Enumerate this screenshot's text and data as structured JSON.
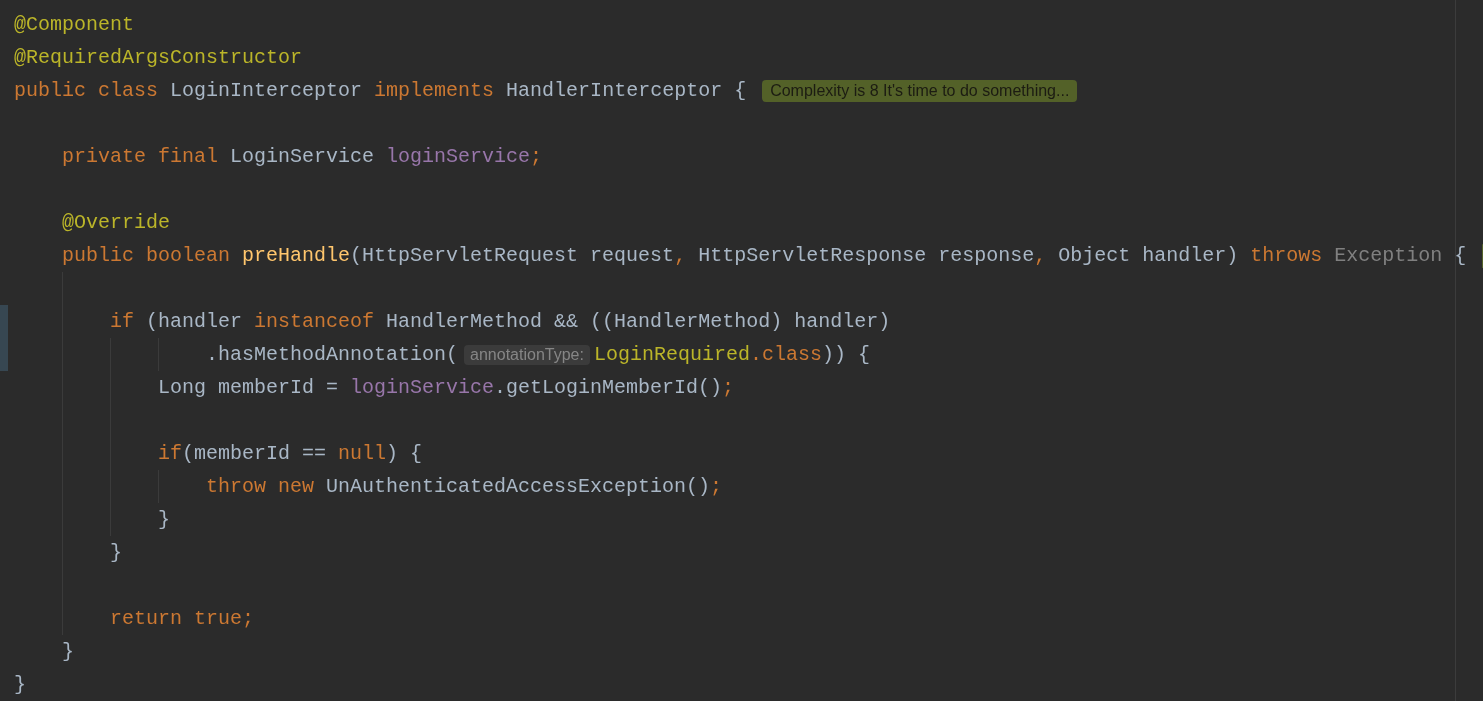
{
  "editor": {
    "lines": [
      {
        "kind": "code",
        "modified": false,
        "segments": [
          {
            "kind": "code",
            "tokens": [
              {
                "kind": "annotation",
                "text": "@Component"
              }
            ]
          }
        ]
      },
      {
        "kind": "code",
        "modified": false,
        "segments": [
          {
            "kind": "code",
            "tokens": [
              {
                "kind": "annotation",
                "text": "@RequiredArgsConstructor"
              }
            ]
          }
        ]
      },
      {
        "kind": "code",
        "modified": false,
        "segments": [
          {
            "kind": "code",
            "tokens": [
              {
                "kind": "keyword",
                "text": "public class "
              },
              {
                "kind": "plain",
                "text": "LoginInterceptor "
              },
              {
                "kind": "keyword",
                "text": "implements "
              },
              {
                "kind": "plain",
                "text": "HandlerInterceptor {"
              }
            ]
          },
          {
            "kind": "badge",
            "text": "Complexity is 8 It's time to do something..."
          }
        ],
        "children": [
          {
            "kind": "blank",
            "modified": false
          },
          {
            "kind": "code",
            "modified": false,
            "segments": [
              {
                "kind": "code",
                "tokens": [
                  {
                    "kind": "keyword",
                    "text": "private final "
                  },
                  {
                    "kind": "plain",
                    "text": "LoginService "
                  },
                  {
                    "kind": "field",
                    "text": "loginService"
                  },
                  {
                    "kind": "keyword",
                    "text": ";"
                  }
                ]
              }
            ]
          },
          {
            "kind": "blank",
            "modified": false
          },
          {
            "kind": "code",
            "modified": false,
            "segments": [
              {
                "kind": "code",
                "tokens": [
                  {
                    "kind": "annotation",
                    "text": "@Override"
                  }
                ]
              }
            ]
          },
          {
            "kind": "code",
            "modified": false,
            "segments": [
              {
                "kind": "code",
                "tokens": [
                  {
                    "kind": "keyword",
                    "text": "public boolean "
                  },
                  {
                    "kind": "method",
                    "text": "preHandle"
                  },
                  {
                    "kind": "plain",
                    "text": "(HttpServletRequest request"
                  },
                  {
                    "kind": "keyword",
                    "text": ", "
                  },
                  {
                    "kind": "plain",
                    "text": "HttpServletResponse response"
                  },
                  {
                    "kind": "keyword",
                    "text": ", "
                  },
                  {
                    "kind": "plain",
                    "text": "Object handler) "
                  },
                  {
                    "kind": "keyword",
                    "text": "throws "
                  },
                  {
                    "kind": "dim",
                    "text": "Exception "
                  },
                  {
                    "kind": "plain",
                    "text": "{"
                  }
                ]
              },
              {
                "kind": "badge"
              }
            ],
            "children": [
              {
                "kind": "blank",
                "modified": false
              },
              {
                "kind": "code",
                "modified": true,
                "segments": [
                  {
                    "kind": "code",
                    "tokens": [
                      {
                        "kind": "keyword",
                        "text": "if "
                      },
                      {
                        "kind": "plain",
                        "text": "(handler "
                      },
                      {
                        "kind": "keyword",
                        "text": "instanceof "
                      },
                      {
                        "kind": "plain",
                        "text": "HandlerMethod && ((HandlerMethod) handler)"
                      }
                    ]
                  }
                ],
                "children": [
                  {
                    "kind": "continuation",
                    "modified": true,
                    "segments": [
                      {
                        "kind": "code",
                        "tokens": [
                          {
                            "kind": "plain",
                            "text": ".hasMethodAnnotation("
                          }
                        ]
                      },
                      {
                        "kind": "hint",
                        "text": "annotationType:"
                      },
                      {
                        "kind": "code",
                        "tokens": [
                          {
                            "kind": "annotation",
                            "text": "LoginRequired"
                          },
                          {
                            "kind": "keyword",
                            "text": ".class"
                          },
                          {
                            "kind": "plain",
                            "text": ")) {"
                          }
                        ]
                      }
                    ]
                  },
                  {
                    "kind": "code",
                    "modified": false,
                    "segments": [
                      {
                        "kind": "code",
                        "tokens": [
                          {
                            "kind": "plain",
                            "text": "Long memberId = "
                          },
                          {
                            "kind": "field",
                            "text": "loginService"
                          },
                          {
                            "kind": "plain",
                            "text": ".getLoginMemberId()"
                          },
                          {
                            "kind": "keyword",
                            "text": ";"
                          }
                        ]
                      }
                    ]
                  },
                  {
                    "kind": "blank",
                    "modified": false
                  },
                  {
                    "kind": "code",
                    "modified": false,
                    "segments": [
                      {
                        "kind": "code",
                        "tokens": [
                          {
                            "kind": "keyword",
                            "text": "if"
                          },
                          {
                            "kind": "plain",
                            "text": "(memberId == "
                          },
                          {
                            "kind": "keyword",
                            "text": "null"
                          },
                          {
                            "kind": "plain",
                            "text": ") {"
                          }
                        ]
                      }
                    ],
                    "children": [
                      {
                        "kind": "code",
                        "modified": false,
                        "segments": [
                          {
                            "kind": "code",
                            "tokens": [
                              {
                                "kind": "keyword",
                                "text": "throw new "
                              },
                              {
                                "kind": "plain",
                                "text": "UnAuthenticatedAccessException()"
                              },
                              {
                                "kind": "keyword",
                                "text": ";"
                              }
                            ]
                          }
                        ]
                      }
                    ]
                  },
                  {
                    "kind": "code",
                    "modified": false,
                    "segments": [
                      {
                        "kind": "code",
                        "tokens": [
                          {
                            "kind": "plain",
                            "text": "}"
                          }
                        ]
                      }
                    ]
                  }
                ]
              },
              {
                "kind": "code",
                "modified": false,
                "segments": [
                  {
                    "kind": "code",
                    "tokens": [
                      {
                        "kind": "plain",
                        "text": "}"
                      }
                    ]
                  }
                ]
              },
              {
                "kind": "blank",
                "modified": false
              },
              {
                "kind": "code",
                "modified": false,
                "segments": [
                  {
                    "kind": "code",
                    "tokens": [
                      {
                        "kind": "keyword",
                        "text": "return true;"
                      }
                    ]
                  }
                ]
              }
            ]
          },
          {
            "kind": "code",
            "modified": false,
            "segments": [
              {
                "kind": "code",
                "tokens": [
                  {
                    "kind": "plain",
                    "text": "}"
                  }
                ]
              }
            ]
          }
        ]
      },
      {
        "kind": "code",
        "modified": false,
        "segments": [
          {
            "kind": "code",
            "tokens": [
              {
                "kind": "plain",
                "text": "}"
              }
            ]
          }
        ]
      }
    ]
  }
}
